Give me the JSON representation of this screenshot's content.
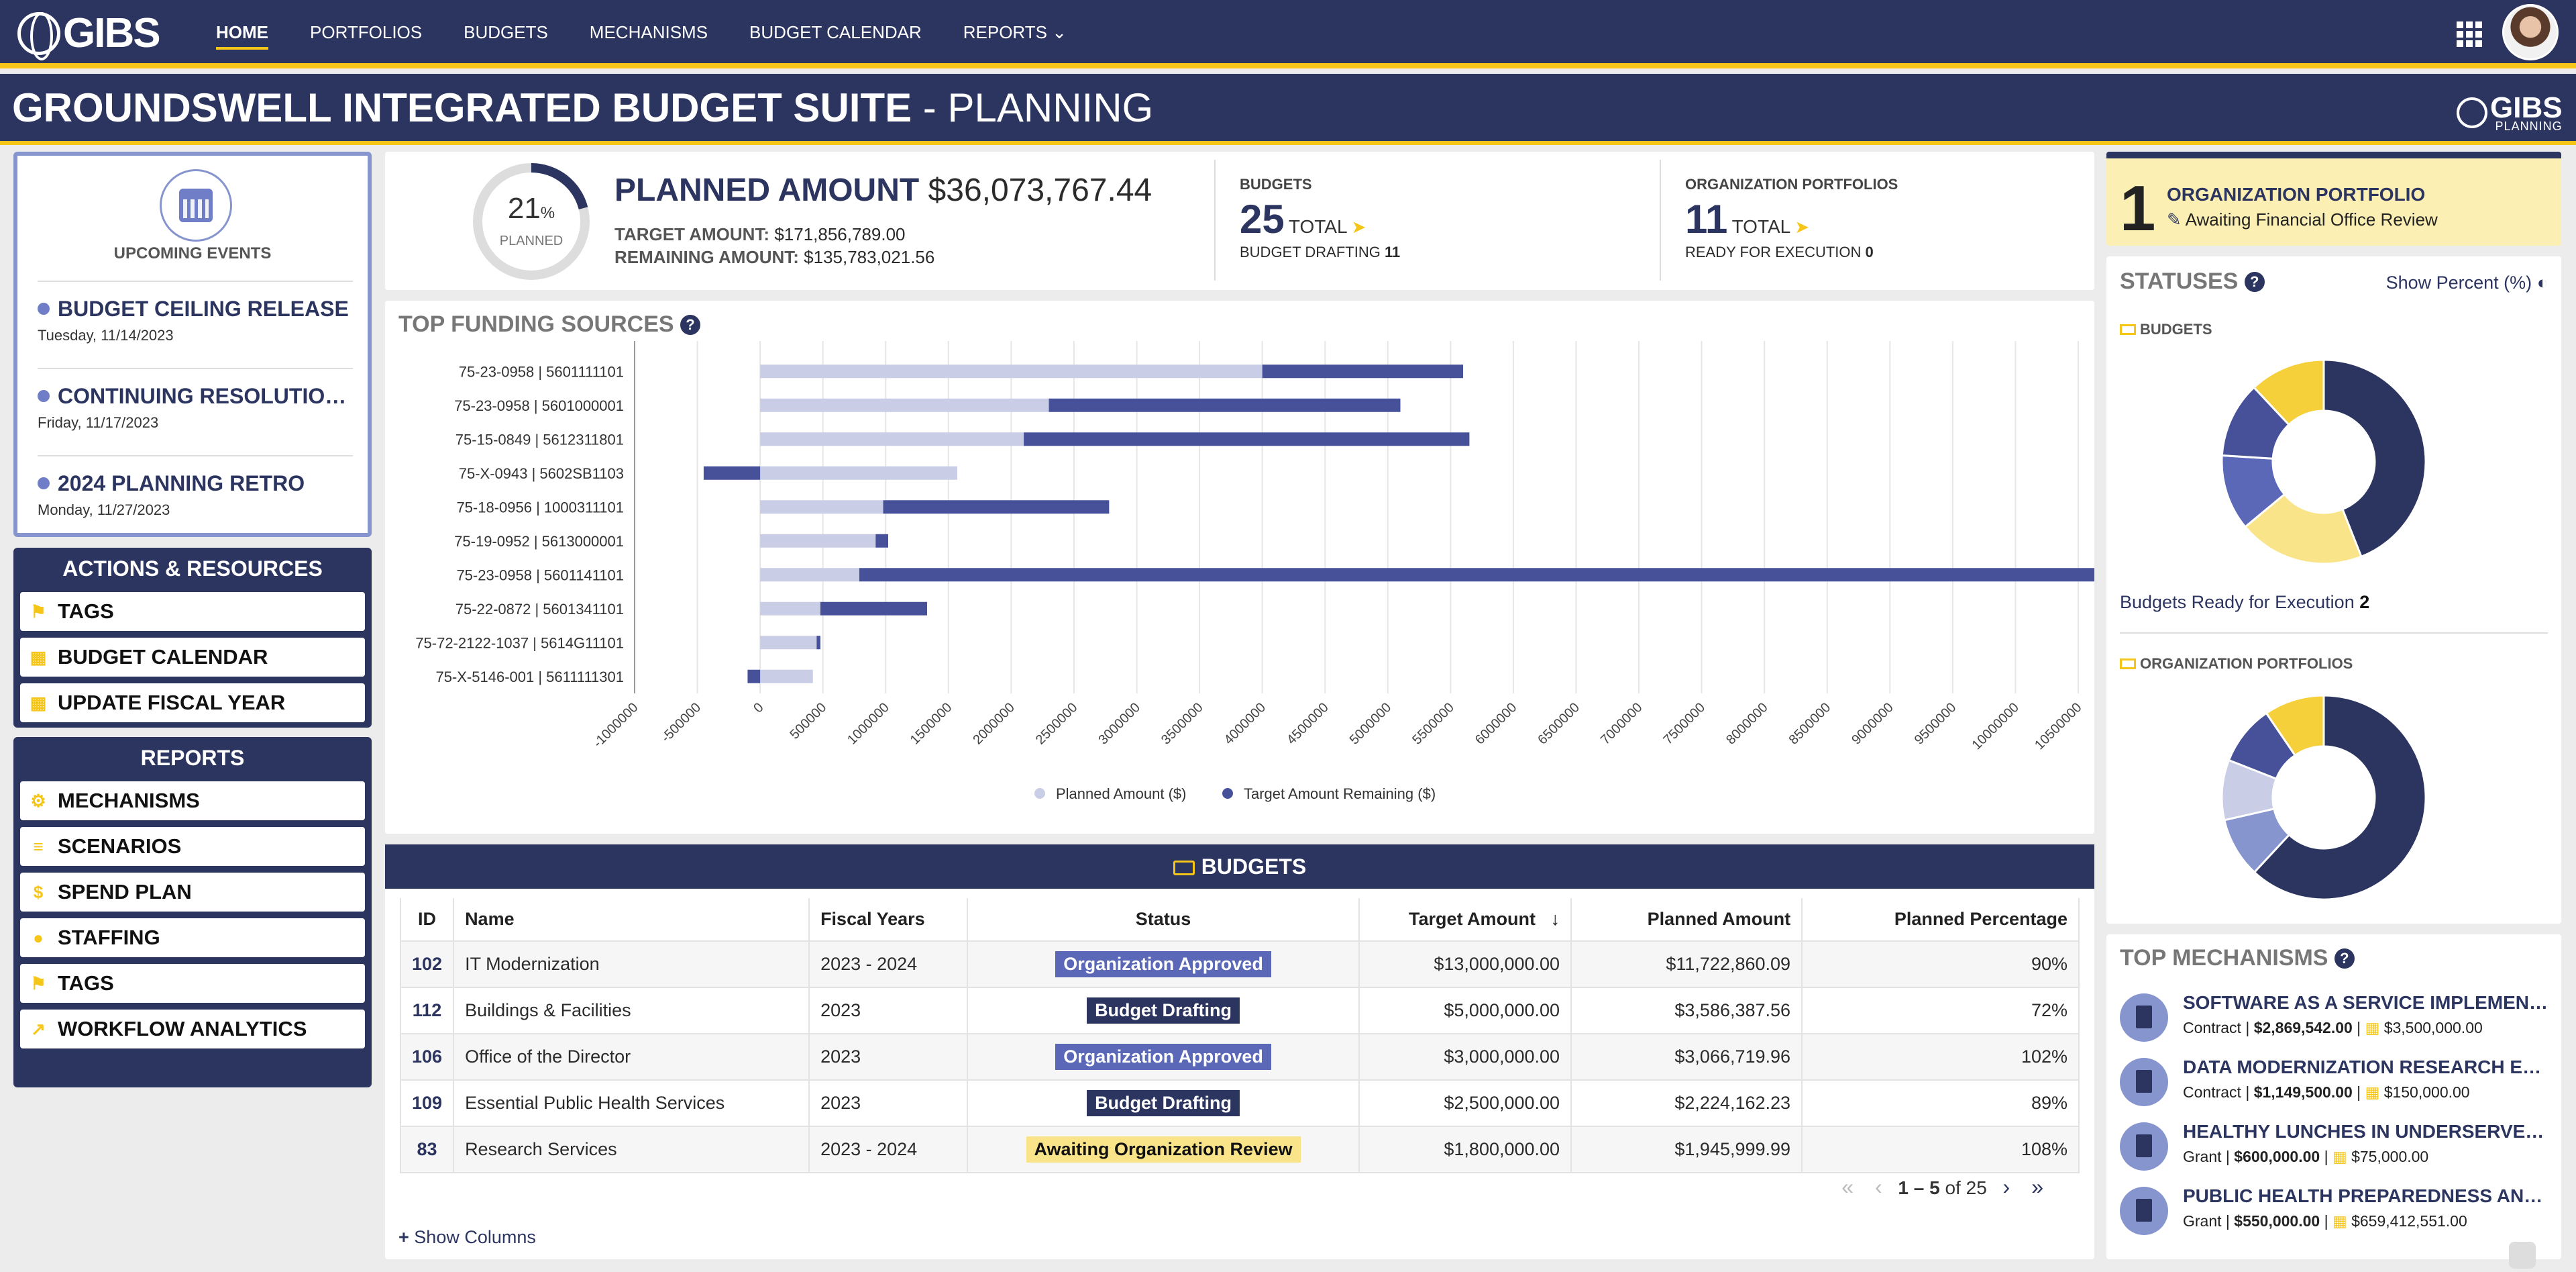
{
  "nav": {
    "logo": "GIBS",
    "links": [
      "HOME",
      "PORTFOLIOS",
      "BUDGETS",
      "MECHANISMS",
      "BUDGET CALENDAR",
      "REPORTS"
    ],
    "active": "HOME"
  },
  "title": {
    "main": "GROUNDSWELL INTEGRATED BUDGET SUITE",
    "sep": " - ",
    "sub": "PLANNING",
    "logo": "GIBS",
    "logo_sub": "PLANNING"
  },
  "events": {
    "label": "UPCOMING EVENTS",
    "items": [
      {
        "title": "BUDGET CEILING RELEASE",
        "date": "Tuesday, 11/14/2023"
      },
      {
        "title": "CONTINUING RESOLUTION END",
        "date": "Friday, 11/17/2023"
      },
      {
        "title": "2024 PLANNING RETRO",
        "date": "Monday, 11/27/2023"
      }
    ]
  },
  "actions": {
    "title": "ACTIONS & RESOURCES",
    "items": [
      "TAGS",
      "BUDGET CALENDAR",
      "UPDATE FISCAL YEAR"
    ]
  },
  "reports": {
    "title": "REPORTS",
    "items": [
      "MECHANISMS",
      "SCENARIOS",
      "SPEND PLAN",
      "STAFFING",
      "TAGS",
      "WORKFLOW ANALYTICS"
    ]
  },
  "summary": {
    "percent": 21,
    "percent_sym": "%",
    "planned_label": "PLANNED",
    "planned_amount_label": "PLANNED AMOUNT",
    "planned_amount": "$36,073,767.44",
    "target_label": "TARGET AMOUNT:",
    "target_value": "$171,856,789.00",
    "remaining_label": "REMAINING AMOUNT:",
    "remaining_value": "$135,783,021.56",
    "budgets": {
      "head": "BUDGETS",
      "total": "25",
      "total_label": "TOTAL",
      "sub_label": "BUDGET DRAFTING",
      "sub_value": "11"
    },
    "portfolios": {
      "head": "ORGANIZATION PORTFOLIOS",
      "total": "11",
      "total_label": "TOTAL",
      "sub_label": "READY FOR EXECUTION",
      "sub_value": "0"
    }
  },
  "funding": {
    "title": "TOP FUNDING SOURCES"
  },
  "chart_data": {
    "type": "bar",
    "orientation": "horizontal",
    "stacked": true,
    "categories": [
      "75-23-0958 | 5601111101",
      "75-23-0958 | 5601000001",
      "75-15-0849 | 5612311801",
      "75-X-0943 | 5602SB1103",
      "75-18-0956 | 1000311101",
      "75-19-0952 | 5613000001",
      "75-23-0958 | 5601141101",
      "75-22-0872 | 5601341101",
      "75-72-2122-1037 | 5614G11101",
      "75-X-5146-001 | 5611111301"
    ],
    "series": [
      {
        "name": "Planned Amount ($)",
        "color": "#c9cde6",
        "values": [
          4000000,
          2300000,
          2100000,
          1570000,
          980000,
          920000,
          790000,
          480000,
          450000,
          420000
        ]
      },
      {
        "name": "Target Amount Remaining ($)",
        "color": "#46519a",
        "values": [
          1600000,
          2800000,
          3550000,
          -450000,
          1800000,
          100000,
          9900000,
          850000,
          30000,
          -100000
        ]
      }
    ],
    "xlim": [
      -1000000,
      10500000
    ],
    "xticks": [
      -1000000,
      -500000,
      0,
      500000,
      1000000,
      1500000,
      2000000,
      2500000,
      3000000,
      3500000,
      4000000,
      4500000,
      5000000,
      5500000,
      6000000,
      6500000,
      7000000,
      7500000,
      8000000,
      8500000,
      9000000,
      9500000,
      10000000,
      10500000
    ],
    "legend_position": "bottom",
    "grid": true
  },
  "budgets": {
    "title": "BUDGETS",
    "columns": [
      "ID",
      "Name",
      "Fiscal Years",
      "Status",
      "Target Amount",
      "Planned Amount",
      "Planned Percentage"
    ],
    "rows": [
      {
        "id": "102",
        "name": "IT Modernization",
        "fy": "2023 - 2024",
        "status": "Organization Approved",
        "status_kind": "approved",
        "target": "$13,000,000.00",
        "planned": "$11,722,860.09",
        "pct": "90%"
      },
      {
        "id": "112",
        "name": "Buildings & Facilities",
        "fy": "2023",
        "status": "Budget Drafting",
        "status_kind": "draft",
        "target": "$5,000,000.00",
        "planned": "$3,586,387.56",
        "pct": "72%"
      },
      {
        "id": "106",
        "name": "Office of the Director",
        "fy": "2023",
        "status": "Organization Approved",
        "status_kind": "approved",
        "target": "$3,000,000.00",
        "planned": "$3,066,719.96",
        "pct": "102%"
      },
      {
        "id": "109",
        "name": "Essential Public Health Services",
        "fy": "2023",
        "status": "Budget Drafting",
        "status_kind": "draft",
        "target": "$2,500,000.00",
        "planned": "$2,224,162.23",
        "pct": "89%"
      },
      {
        "id": "83",
        "name": "Research Services",
        "fy": "2023 - 2024",
        "status": "Awaiting Organization Review",
        "status_kind": "await",
        "target": "$1,800,000.00",
        "planned": "$1,945,999.99",
        "pct": "108%"
      }
    ],
    "pager": {
      "range": "1 – 5",
      "of": "of 25"
    },
    "show_columns": "Show Columns"
  },
  "org_portfolio": {
    "count": "1",
    "label": "ORGANIZATION PORTFOLIO",
    "status": "Awaiting Financial Office Review"
  },
  "statuses": {
    "title": "STATUSES",
    "show_percent": "Show Percent (%)",
    "budgets_label": "BUDGETS",
    "budgets_ready_label": "Budgets Ready for Execution",
    "budgets_ready_value": "2",
    "portfolios_label": "ORGANIZATION PORTFOLIOS",
    "budgets_donut": [
      {
        "value": 11,
        "color": "#2c3560"
      },
      {
        "value": 5,
        "color": "#f9e48a"
      },
      {
        "value": 3,
        "color": "#5b68b8"
      },
      {
        "value": 3,
        "color": "#46519a"
      },
      {
        "value": 3,
        "color": "#f5d03a"
      }
    ],
    "portfolios_donut": [
      {
        "value": 6.5,
        "color": "#2c3560"
      },
      {
        "value": 1.0,
        "color": "#8795cf"
      },
      {
        "value": 1.0,
        "color": "#c9cde6"
      },
      {
        "value": 1.0,
        "color": "#46519a"
      },
      {
        "value": 1.0,
        "color": "#f5d03a"
      }
    ]
  },
  "mechanisms": {
    "title": "TOP MECHANISMS",
    "items": [
      {
        "title": "SOFTWARE AS A SERVICE IMPLEMENTATION",
        "type": "Contract",
        "amount": "$2,869,542.00",
        "other": "$3,500,000.00"
      },
      {
        "title": "DATA MODERNIZATION RESEARCH EQUIPMENT",
        "type": "Contract",
        "amount": "$1,149,500.00",
        "other": "$150,000.00"
      },
      {
        "title": "HEALTHY LUNCHES IN UNDERSERVED NEIGHBORHOODS",
        "type": "Grant",
        "amount": "$600,000.00",
        "other": "$75,000.00"
      },
      {
        "title": "PUBLIC HEALTH PREPAREDNESS AND RESPONSE",
        "type": "Grant",
        "amount": "$550,000.00",
        "other": "$659,412,551.00"
      }
    ]
  }
}
